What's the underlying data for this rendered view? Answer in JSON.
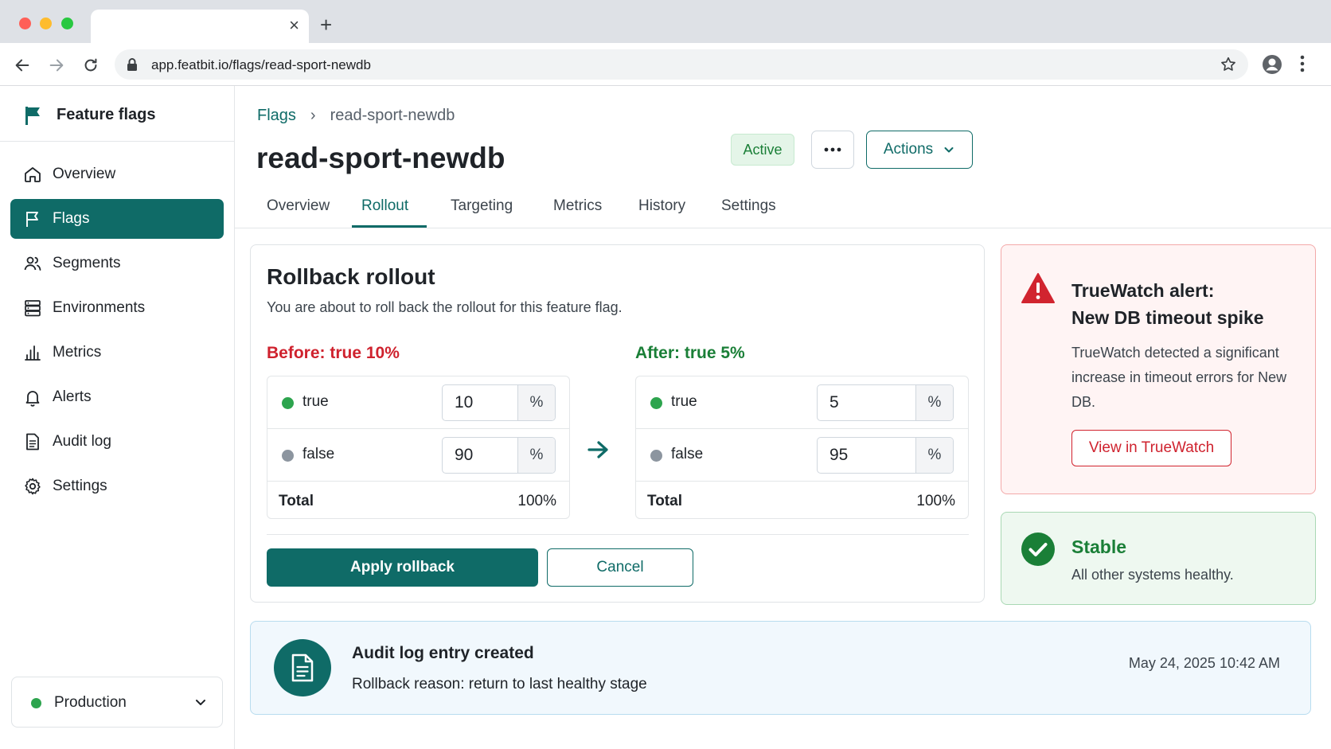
{
  "browser": {
    "url": "app.featbit.io/flags/read-sport-newdb",
    "tab_close": "×",
    "new_tab": "+"
  },
  "sidebar": {
    "brand": "Feature flags",
    "items": [
      {
        "label": "Overview",
        "icon": "home-icon"
      },
      {
        "label": "Flags",
        "icon": "flag-icon",
        "active": true
      },
      {
        "label": "Segments",
        "icon": "users-icon"
      },
      {
        "label": "Environments",
        "icon": "server-icon"
      },
      {
        "label": "Metrics",
        "icon": "bar-chart-icon"
      },
      {
        "label": "Alerts",
        "icon": "bell-icon"
      },
      {
        "label": "Audit log",
        "icon": "document-icon"
      },
      {
        "label": "Settings",
        "icon": "gear-icon"
      }
    ],
    "environment": "Production"
  },
  "header": {
    "breadcrumb_root": "Flags",
    "breadcrumb_sep": "›",
    "breadcrumb_current": "read-sport-newdb",
    "title": "read-sport-newdb",
    "status": "Active",
    "actions_label": "Actions"
  },
  "tabs": [
    {
      "label": "Overview"
    },
    {
      "label": "Rollout",
      "active": true
    },
    {
      "label": "Targeting"
    },
    {
      "label": "Metrics"
    },
    {
      "label": "History"
    },
    {
      "label": "Settings"
    }
  ],
  "rollback": {
    "title": "Rollback rollout",
    "description": "You are about to roll back the rollout for this feature flag.",
    "before": {
      "label": "Before: true 10%",
      "rows": [
        {
          "name": "true",
          "value": "10",
          "unit": "%"
        },
        {
          "name": "false",
          "value": "90",
          "unit": "%"
        }
      ],
      "total_label": "Total",
      "total_value": "100%"
    },
    "after": {
      "label": "After: true 5%",
      "rows": [
        {
          "name": "true",
          "value": "5",
          "unit": "%"
        },
        {
          "name": "false",
          "value": "95",
          "unit": "%"
        }
      ],
      "total_label": "Total",
      "total_value": "100%"
    },
    "apply_label": "Apply rollback",
    "cancel_label": "Cancel"
  },
  "alert": {
    "title_line1": "TrueWatch alert:",
    "title_line2": "New DB timeout spike",
    "text": "TrueWatch detected a significant increase in timeout errors for New DB.",
    "button": "View in TrueWatch"
  },
  "stable": {
    "title": "Stable",
    "text": "All other systems healthy."
  },
  "audit": {
    "title": "Audit log entry created",
    "text": "Rollback reason: return to last healthy stage",
    "timestamp": "May 24, 2025 10:42 AM"
  },
  "colors": {
    "accent": "#0f6b67",
    "danger": "#cf222e",
    "success": "#1a7f37"
  }
}
